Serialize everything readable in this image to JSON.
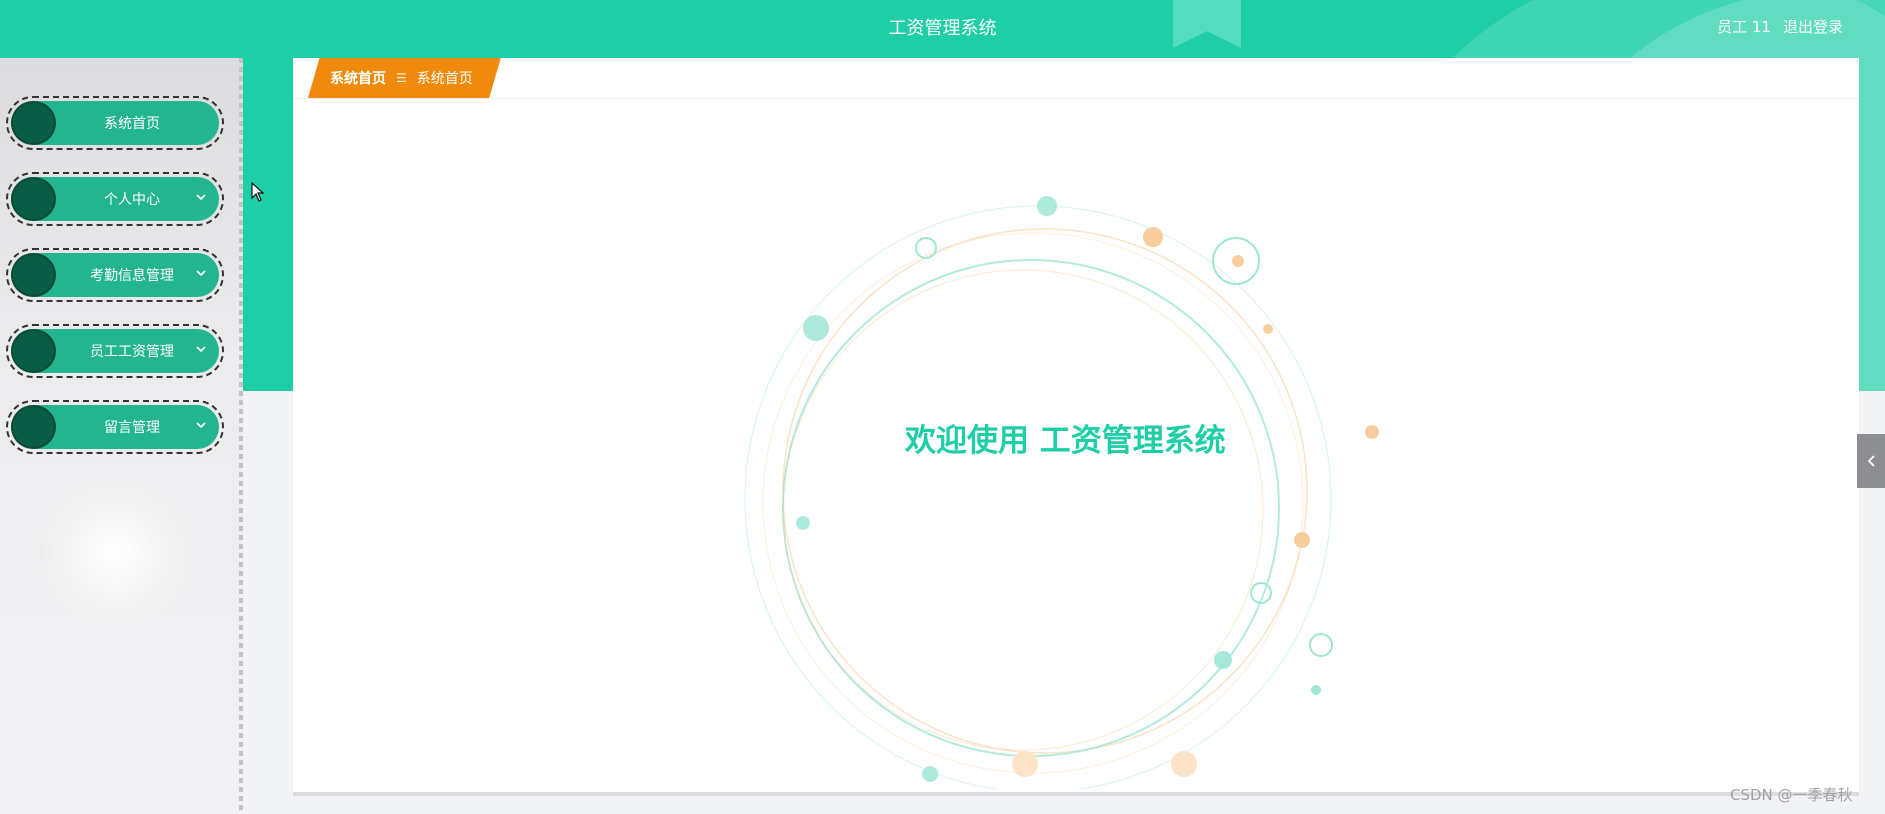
{
  "header": {
    "title": "工资管理系统",
    "user": "员工 11",
    "logout": "退出登录"
  },
  "sidebar": {
    "items": [
      {
        "label": "系统首页",
        "has_arrow": false
      },
      {
        "label": "个人中心",
        "has_arrow": true
      },
      {
        "label": "考勤信息管理",
        "has_arrow": true
      },
      {
        "label": "员工工资管理",
        "has_arrow": true
      },
      {
        "label": "留言管理",
        "has_arrow": true
      }
    ]
  },
  "breadcrumb": {
    "home": "系统首页",
    "separator": "☰",
    "current": "系统首页"
  },
  "main": {
    "welcome_prefix": "欢迎使用",
    "welcome_app": "工资管理系统"
  },
  "watermark": "CSDN @一季春秋",
  "colors": {
    "primary": "#1ecea6",
    "nav_pill": "#22b58f",
    "nav_dot": "#095c46",
    "breadcrumb": "#f08a0c",
    "ring_teal": "#9fe6d5",
    "ring_orange": "#f8cf9c"
  },
  "icons": {
    "nav_arrow": "chevron-down-icon",
    "collapse": "chevron-left-icon",
    "cursor": "mouse-cursor-icon"
  }
}
